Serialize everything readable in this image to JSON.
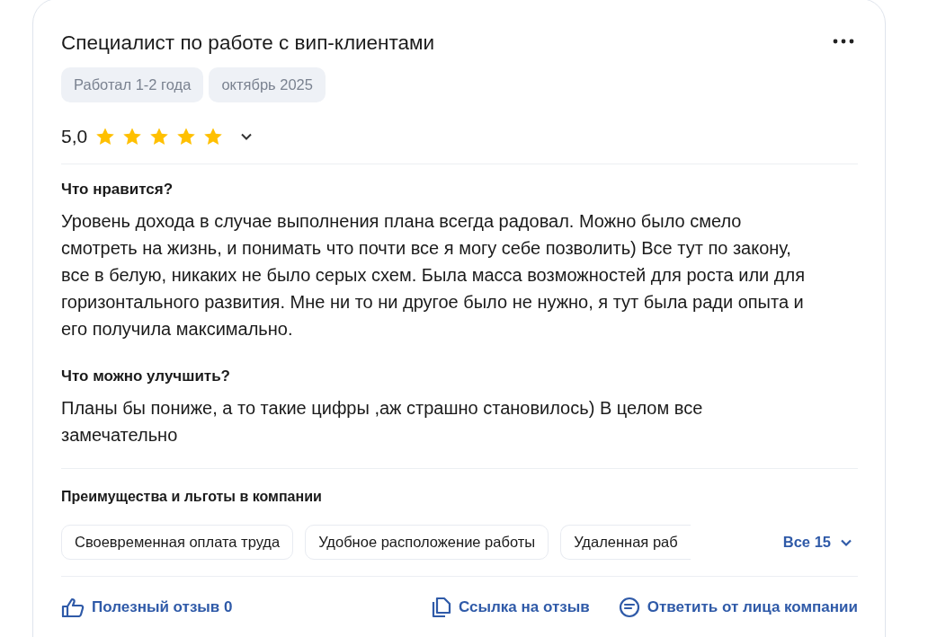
{
  "review": {
    "title": "Специалист по работе с вип-клиентами",
    "tags": [
      "Работал 1-2 года",
      "октябрь 2025"
    ],
    "rating": "5,0",
    "stars": 5,
    "sections": [
      {
        "heading": "Что нравится?",
        "text": "Уровень дохода в случае выполнения плана всегда радовал. Можно было смело смотреть на жизнь, и понимать что почти все я могу себе позволить) Все тут по закону, все в белую, никаких не было серых схем. Была масса возможностей для роста или для горизонтального развития. Мне ни то ни другое было не нужно, я тут была ради опыта и его получила максимально."
      },
      {
        "heading": "Что можно улучшить?",
        "text": "Планы бы пониже, а то такие цифры ,аж страшно становилось) В целом все замечательно"
      }
    ],
    "benefits": {
      "heading": "Преимущества и льготы в компании",
      "items": [
        "Своевременная оплата труда",
        "Удобное расположение работы",
        "Удаленная раб"
      ],
      "more": "Все 15"
    },
    "actions": [
      {
        "kind": "like",
        "label": "Полезный отзыв 0"
      },
      {
        "kind": "link",
        "label": "Ссылка на отзыв"
      },
      {
        "kind": "reply",
        "label": "Ответить от лица компании"
      }
    ]
  }
}
